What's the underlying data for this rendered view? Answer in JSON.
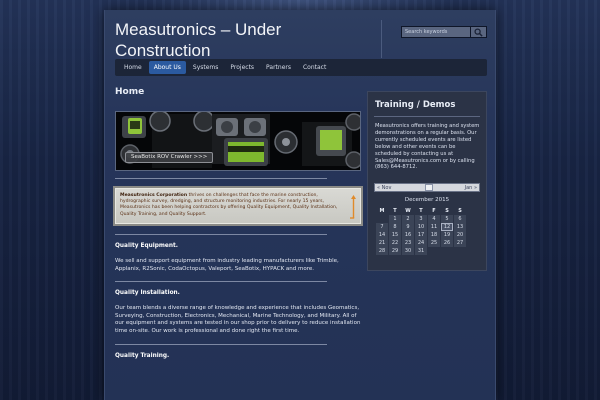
{
  "site": {
    "title": "Measutronics – Under Construction"
  },
  "search": {
    "placeholder": "Search keywords"
  },
  "nav": {
    "items": [
      "Home",
      "About Us",
      "Systems",
      "Projects",
      "Partners",
      "Contact"
    ],
    "active_index": 1
  },
  "page": {
    "title": "Home"
  },
  "banner": {
    "caption": "SeaBotix ROV Crawler  >>>"
  },
  "notice": {
    "company": "Measutronics Corporation",
    "text": " thrives on challenges that face the marine construction, hydrographic survey, dredging, and structure monitoring industries. For nearly 15 years, Measutronics has been helping contractors by offering Quality Equipment, Quality Installation, Quality Training, and Quality Support."
  },
  "sections": [
    {
      "heading": "Quality Equipment.",
      "body": "We sell and support equipment from industry leading manufacturers like Trimble, Applanix, R2Sonic, CodaOctopus, Valeport, SeaBotix, HYPACK and more."
    },
    {
      "heading": "Quality Installation.",
      "body": "Our team blends a diverse range of knowledge and experience that includes Geomatics, Surveying, Construction, Electronics, Mechanical, Marine Technology, and Military.  All of our equipment and systems are tested in our shop prior to delivery to reduce installation time on-site.  Our work is professional and done right the first time."
    },
    {
      "heading": "Quality Training.",
      "body": ""
    }
  ],
  "sidebar": {
    "title": "Training / Demos",
    "text": "Measutronics offers training and system demonstrations on a regular basis. Our currently scheduled events are listed below and other events can be scheduled by contacting us at Sales@Measutronics.com or by calling (863) 644-8712."
  },
  "calendar": {
    "prev": "« Nov",
    "next": "Jan »",
    "caption": "December 2015",
    "weekdays": [
      "M",
      "T",
      "W",
      "T",
      "F",
      "S",
      "S"
    ],
    "weeks": [
      [
        "",
        "1",
        "2",
        "3",
        "4",
        "5",
        "6"
      ],
      [
        "7",
        "8",
        "9",
        "10",
        "11",
        "12",
        "13"
      ],
      [
        "14",
        "15",
        "16",
        "17",
        "18",
        "19",
        "20"
      ],
      [
        "21",
        "22",
        "23",
        "24",
        "25",
        "26",
        "27"
      ],
      [
        "28",
        "29",
        "30",
        "31",
        "",
        "",
        ""
      ]
    ],
    "today": "12"
  }
}
